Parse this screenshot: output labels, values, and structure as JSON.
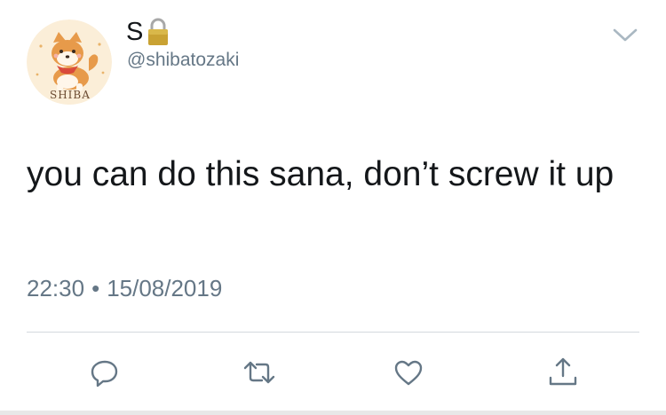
{
  "user": {
    "display_name": "S",
    "handle": "@shibatozaki",
    "protected_icon": "lock-icon",
    "avatar_text": "SHIBA"
  },
  "tweet": {
    "text": "you can do this sana, don’t screw it up",
    "time": "22:30",
    "separator": "•",
    "date": "15/08/2019"
  },
  "actions": [
    {
      "name": "reply",
      "icon": "speech-bubble-icon"
    },
    {
      "name": "retweet",
      "icon": "retweet-icon"
    },
    {
      "name": "like",
      "icon": "heart-icon"
    },
    {
      "name": "share",
      "icon": "share-icon"
    }
  ],
  "colors": {
    "text": "#14171a",
    "secondary": "#657786",
    "divider": "#d4d9de",
    "icon": "#657786"
  }
}
